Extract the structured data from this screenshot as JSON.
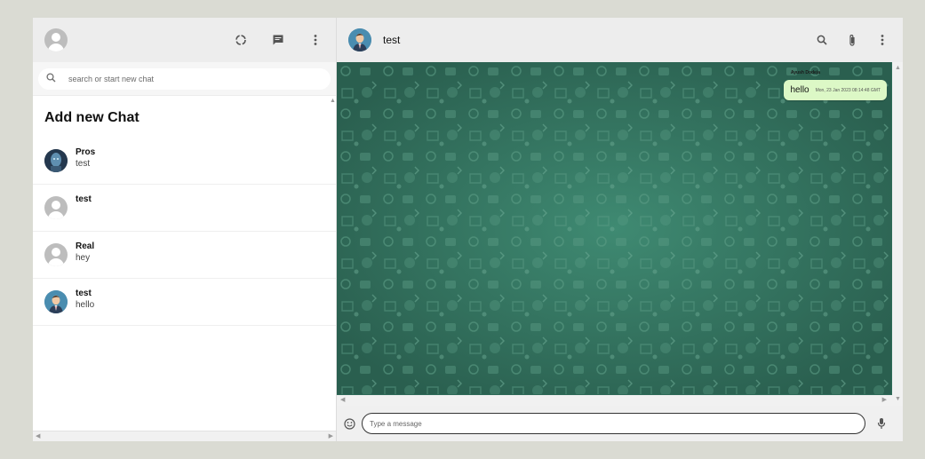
{
  "sidebar": {
    "search": {
      "placeholder": "search or start new chat"
    },
    "add_chat_label": "Add new Chat",
    "chats": [
      {
        "name": "Pros",
        "last_message": "test",
        "avatar": "photo-avatar-blue"
      },
      {
        "name": "test",
        "last_message": "",
        "avatar": "default-avatar"
      },
      {
        "name": "Real",
        "last_message": "hey",
        "avatar": "default-avatar"
      },
      {
        "name": "test",
        "last_message": "hello",
        "avatar": "photo-avatar-man"
      }
    ]
  },
  "main": {
    "title": "test",
    "messages": [
      {
        "sender": "Ayush Dodeja",
        "text": "hello",
        "timestamp": "Mon, 23 Jan 2023 08:14:48 GMT"
      }
    ],
    "composer": {
      "placeholder": "Type a message"
    }
  },
  "colors": {
    "background": "#dadbd3",
    "header": "#ededed",
    "chat_background": "#2e6b58",
    "sent_bubble": "#dcf8c6"
  }
}
